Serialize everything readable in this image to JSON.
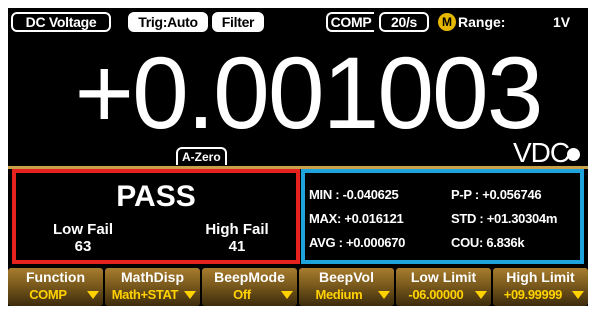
{
  "status_bar": {
    "function_label": "DC Voltage",
    "trigger_label": "Trig:Auto",
    "filter_label": "Filter",
    "comp_label": "COMP",
    "rate_label": "20/s",
    "math_badge": "M",
    "range_label": "Range:",
    "range_value": "1V"
  },
  "display": {
    "reading": "+0.001003",
    "azero_label": "A-Zero",
    "unit": "VDC"
  },
  "comparator": {
    "result": "PASS",
    "low_fail_label": "Low Fail",
    "low_fail_count": "63",
    "high_fail_label": "High Fail",
    "high_fail_count": "41",
    "border_color": "#e5221e"
  },
  "statistics": {
    "border_color": "#1fa3dc",
    "min": "MIN : -0.040625",
    "max": "MAX: +0.016121",
    "avg": "AVG : +0.000670",
    "pp": "P-P : +0.056746",
    "std": "STD : +01.30304m",
    "cou": "COU: 6.836k"
  },
  "softkeys": [
    {
      "label": "Function",
      "value": "COMP"
    },
    {
      "label": "MathDisp",
      "value": "Math+STAT"
    },
    {
      "label": "BeepMode",
      "value": "Off"
    },
    {
      "label": "BeepVol",
      "value": "Medium"
    },
    {
      "label": "Low Limit",
      "value": "-06.00000"
    },
    {
      "label": "High Limit",
      "value": "+09.99999"
    }
  ],
  "icons": {
    "math_badge_icon": "circle-m-icon",
    "hold_icon": "filled-circle-icon",
    "dropdown_icon": "triangle-down-icon"
  }
}
